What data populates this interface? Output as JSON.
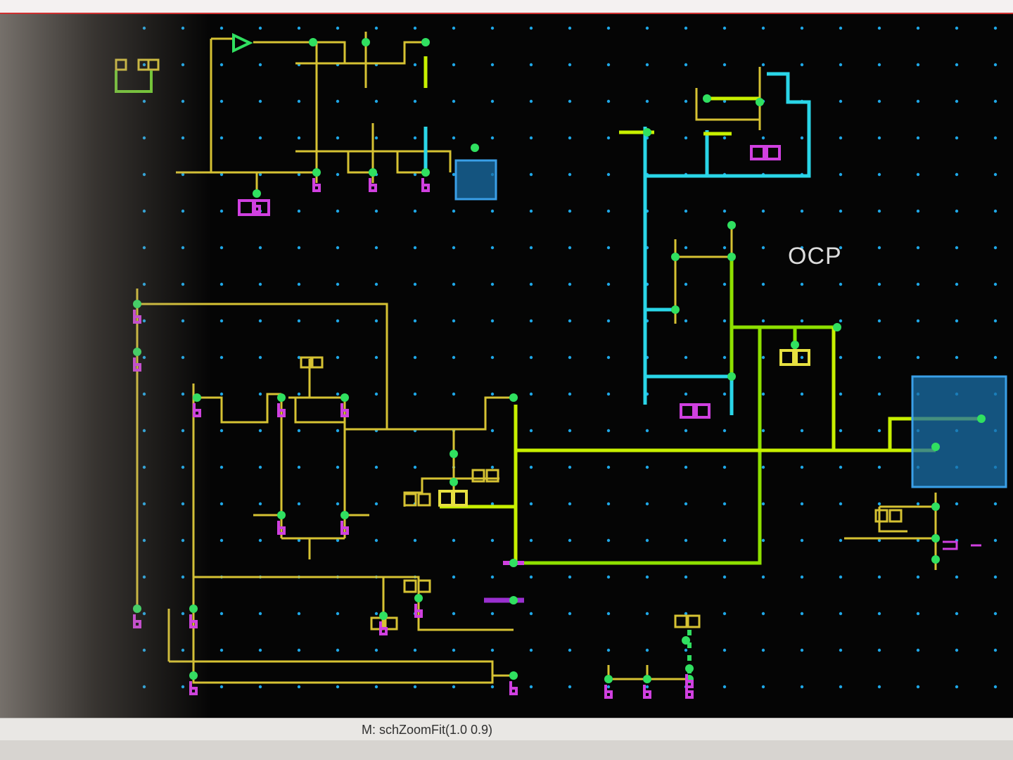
{
  "schematic": {
    "label": "OCP",
    "colors": {
      "background": "#050505",
      "grid_dot": "#1ea7e6",
      "wire_yellow": "#d6c233",
      "wire_green": "#8ee000",
      "wire_lime": "#c8f000",
      "wire_cyan": "#2ad6e8",
      "pin_magenta": "#d040e0",
      "pin_green": "#30e060",
      "selection_box": "#1f7fc4"
    }
  },
  "status_bar": {
    "message": "M: schZoomFit(1.0 0.9)"
  }
}
